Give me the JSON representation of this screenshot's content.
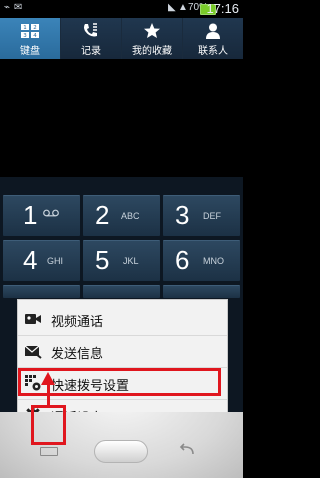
{
  "status_bar": {
    "battery_percent": "70%",
    "time": "17:16"
  },
  "tabs": [
    {
      "label": "键盘",
      "icon": "keypad-icon",
      "active": true
    },
    {
      "label": "记录",
      "icon": "call-log-icon",
      "active": false
    },
    {
      "label": "我的收藏",
      "icon": "star-icon",
      "active": false
    },
    {
      "label": "联系人",
      "icon": "person-icon",
      "active": false
    }
  ],
  "keypad": {
    "keys": [
      {
        "num": "1",
        "letters": "",
        "icon": "voicemail-icon"
      },
      {
        "num": "2",
        "letters": "ABC"
      },
      {
        "num": "3",
        "letters": "DEF"
      },
      {
        "num": "4",
        "letters": "GHI"
      },
      {
        "num": "5",
        "letters": "JKL"
      },
      {
        "num": "6",
        "letters": "MNO"
      }
    ]
  },
  "menu": {
    "items": [
      {
        "label": "视频通话",
        "icon": "video-call-icon"
      },
      {
        "label": "发送信息",
        "icon": "send-message-icon"
      },
      {
        "label": "快速拨号设置",
        "icon": "speed-dial-settings-icon"
      },
      {
        "label": "通话设定",
        "icon": "gear-icon"
      }
    ]
  },
  "colors": {
    "highlight": "#e0161e",
    "active_tab": "#3b84b9"
  }
}
